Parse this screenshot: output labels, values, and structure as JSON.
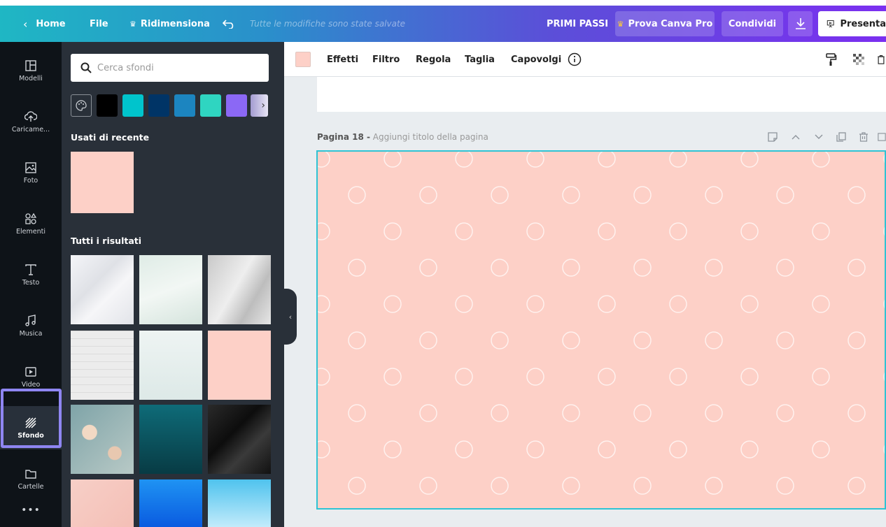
{
  "topbar": {
    "home": "Home",
    "file": "File",
    "resize": "Ridimensiona",
    "saved": "Tutte le modifiche sono state salvate",
    "title": "PRIMI PASSI",
    "pro": "Prova Canva Pro",
    "share": "Condividi",
    "present": "Presenta"
  },
  "sidebar": {
    "items": [
      {
        "label": "Modelli",
        "icon": "template-icon"
      },
      {
        "label": "Caricame...",
        "icon": "upload-icon"
      },
      {
        "label": "Foto",
        "icon": "photo-icon"
      },
      {
        "label": "Elementi",
        "icon": "elements-icon"
      },
      {
        "label": "Testo",
        "icon": "text-icon"
      },
      {
        "label": "Musica",
        "icon": "music-icon"
      },
      {
        "label": "Video",
        "icon": "video-icon"
      },
      {
        "label": "Sfondo",
        "icon": "background-icon"
      },
      {
        "label": "Cartelle",
        "icon": "folder-icon"
      }
    ],
    "more": "•••"
  },
  "panel": {
    "search_placeholder": "Cerca sfondi",
    "swatches": [
      "#000000",
      "#00c4cc",
      "#003466",
      "#1c85c0",
      "#2fd5c1",
      "#8b68f5",
      "#a39bd1"
    ],
    "recent_title": "Usati di recente",
    "all_title": "Tutti i risultati"
  },
  "toolbar": {
    "color": "#fdd0c7",
    "effects": "Effetti",
    "filter": "Filtro",
    "adjust": "Regola",
    "crop": "Taglia",
    "flip": "Capovolgi"
  },
  "page": {
    "label_num": "Pagina 18 -",
    "label_hint": "Aggiungi titolo della pagina",
    "bg_color": "#fdd0c7",
    "frame_color": "#2ec3d4"
  },
  "colors": {
    "accent": "#7b2ff0",
    "teal": "#1fb7c4",
    "highlight": "#8f86f2"
  }
}
